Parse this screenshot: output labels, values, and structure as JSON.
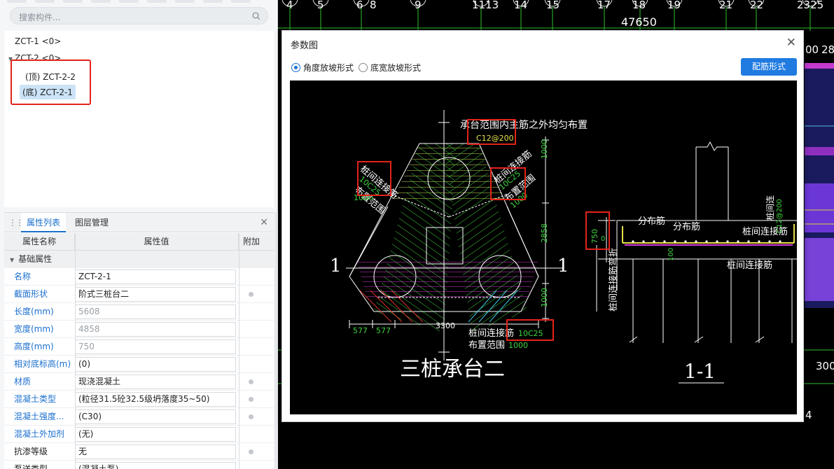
{
  "search": {
    "placeholder": "搜索构件..."
  },
  "tree": {
    "items": [
      "ZCT-1 <0>",
      "ZCT-2 <0>"
    ],
    "children": [
      "(顶) ZCT-2-2",
      "(底) ZCT-2-1"
    ]
  },
  "properties": {
    "tabs": [
      "属性列表",
      "图层管理"
    ],
    "headers": [
      "属性名称",
      "属性值",
      "附加"
    ],
    "group": "基础属性",
    "rows": [
      {
        "name": "名称",
        "value": "ZCT-2-1"
      },
      {
        "name": "截面形状",
        "value": "阶式三桩台二"
      },
      {
        "name": "长度(mm)",
        "value": "5608"
      },
      {
        "name": "宽度(mm)",
        "value": "4858"
      },
      {
        "name": "高度(mm)",
        "value": "750"
      },
      {
        "name": "相对底标高(m)",
        "value": "(0)"
      },
      {
        "name": "材质",
        "value": "现浇混凝土"
      },
      {
        "name": "混凝土类型",
        "value": "(粒径31.5砼32.5级坍落度35~50)"
      },
      {
        "name": "混凝土强度...",
        "value": "(C30)"
      },
      {
        "name": "混凝土外加剂",
        "value": "(无)"
      },
      {
        "name": "抗渗等级",
        "value": "无"
      },
      {
        "name": "泵送类型",
        "value": "(混凝土泵)"
      }
    ]
  },
  "cad": {
    "axis_numbers": [
      "4",
      "5",
      "6",
      "8",
      "9",
      "1113",
      "14",
      "15",
      "17",
      "18",
      "19",
      "21",
      "22",
      "2325"
    ],
    "dimension": "47650",
    "side_labels": [
      "00",
      "28",
      "300",
      "4"
    ]
  },
  "dialog": {
    "title": "参数图",
    "radio_angle": "角度放坡形式",
    "radio_width": "底宽放坡形式",
    "rebar_button": "配筋形式",
    "drawing": {
      "top_note": "承台范围内主筋之外均匀布置",
      "top_rebar": "C12@200",
      "left_label1": "桩间连接筋",
      "left_label2": "10C25",
      "left_label3": "布置范围",
      "left_label4": "1000",
      "right_label1": "桩间连接筋",
      "right_label2": "10C25",
      "right_label3": "布置范围",
      "right_label4": "1000",
      "bottom_label1": "桩间连接筋",
      "bottom_label2": "10C25",
      "bottom_label3": "布置范围",
      "bottom_label4": "1000",
      "dim_1000_top": "1000",
      "dim_2858": "2858",
      "dim_1000_bottom": "1000",
      "dim_577a": "577",
      "dim_577b": "577",
      "dim_3300": "3300",
      "section_mark": "1",
      "plan_title": "三桩承台二",
      "sec_dim_750": "750",
      "sec_dim_0": "0",
      "sec_lbl_fen1": "分布筋",
      "sec_lbl_fen2": "分布筋",
      "sec_lbl_lian": "桩间连接筋",
      "sec_lbl_lian2": "桩间连接筋",
      "sec_lbl_vert": "桩间连接筋弯折",
      "sec_lbl_top_r": "桩间连",
      "sec_lbl_top_r2": "C12@200",
      "sec_lbl_100": "100",
      "section_title": "1-1"
    }
  }
}
